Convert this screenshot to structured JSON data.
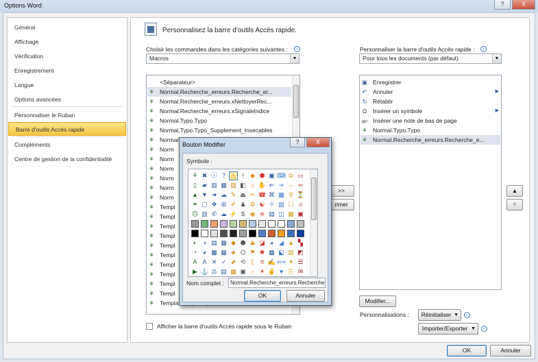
{
  "window": {
    "title": "Options Word",
    "help_label": "?",
    "close_label": "X"
  },
  "nav": {
    "items": [
      {
        "label": "Général"
      },
      {
        "label": "Affichage"
      },
      {
        "label": "Vérification"
      },
      {
        "label": "Enregistrement"
      },
      {
        "label": "Langue"
      },
      {
        "label": "Options avancées"
      },
      {
        "label": "Personnaliser le Ruban"
      },
      {
        "label": "Barre d'outils Accès rapide"
      },
      {
        "label": "Compléments"
      },
      {
        "label": "Centre de gestion de la confidentialité"
      }
    ],
    "selected": "Barre d'outils Accès rapide"
  },
  "main": {
    "header": "Personnalisez la barre d'outils Accès rapide.",
    "left": {
      "choose_label": "Choisir les commandes dans les catégories suivantes :",
      "category_value": "Macros",
      "commands": [
        {
          "label": "<Séparateur>",
          "icon": "none"
        },
        {
          "label": "Normal.Recherche_erreurs.Recherche_er...",
          "icon": "macro-icon",
          "selected": true
        },
        {
          "label": "Normal.Recherche_erreurs.xNettoyerRec...",
          "icon": "macro-icon"
        },
        {
          "label": "Normal.Recherche_erreurs.xSignaleIndice",
          "icon": "macro-icon"
        },
        {
          "label": "Normal.Typo.Typo",
          "icon": "macro-icon"
        },
        {
          "label": "Normal.Typo.Typo_Supplement_Insecables",
          "icon": "macro-icon"
        },
        {
          "label": "Normal.TypoEspaceInsec.espaceInsec",
          "icon": "macro-icon"
        },
        {
          "label": "Norm",
          "icon": "macro-icon"
        },
        {
          "label": "Norm",
          "icon": "macro-icon"
        },
        {
          "label": "Norm",
          "icon": "macro-icon"
        },
        {
          "label": "Norm",
          "icon": "macro-icon"
        },
        {
          "label": "Norm",
          "icon": "macro-icon"
        },
        {
          "label": "Norm",
          "icon": "macro-icon"
        },
        {
          "label": "Templ",
          "icon": "macro-icon"
        },
        {
          "label": "Templ",
          "icon": "macro-icon"
        },
        {
          "label": "Templ",
          "icon": "macro-icon"
        },
        {
          "label": "Templ",
          "icon": "macro-icon"
        },
        {
          "label": "Templ",
          "icon": "macro-icon"
        },
        {
          "label": "Templ",
          "icon": "macro-icon"
        },
        {
          "label": "Templ",
          "icon": "macro-icon"
        },
        {
          "label": "Templ",
          "icon": "macro-icon"
        },
        {
          "label": "Templ",
          "icon": "macro-icon"
        },
        {
          "label": "Templ",
          "icon": "macro-icon"
        },
        {
          "label": "TemplateProject.Typo.xSuppEspacesCon...",
          "icon": "macro-icon"
        }
      ],
      "show_below_label": "Afficher la barre d'outils Accès rapide sous le Ruban"
    },
    "add_button": ">>",
    "remove_button": "rimer",
    "right": {
      "customize_label": "Personnaliser la barre d'outils Accès rapide :",
      "scope_value": "Pour tous les documents (par défaut)",
      "items": [
        {
          "label": "Enregistrer",
          "icon": "save-icon"
        },
        {
          "label": "Annuler",
          "icon": "undo-icon",
          "has_submenu": true
        },
        {
          "label": "Rétablir",
          "icon": "redo-icon"
        },
        {
          "label": "Insérer un symbole",
          "icon": "omega-icon",
          "has_submenu": true
        },
        {
          "label": "Insérer une note de bas de page",
          "icon": "footnote-icon"
        },
        {
          "label": "Normal.Typo.Typo",
          "icon": "macro-icon"
        },
        {
          "label": "Normal.Recherche_erreurs.Recherche_e...",
          "icon": "macro-icon",
          "selected": true
        }
      ],
      "modify_button": "Modifier...",
      "customizations_label": "Personnalisations :",
      "reset_button": "Réinitialiser",
      "import_export_button": "Importer/Exporter",
      "move_up": "▲",
      "move_down": "▼"
    }
  },
  "dialog": {
    "title": "Bouton Modifier",
    "help_label": "?",
    "close_label": "X",
    "symbol_label": "Symbole :",
    "full_name_label": "Nom complet :",
    "full_name_value": "Normal.Recherche_erreurs.Recherche",
    "ok": "OK",
    "cancel": "Annuler",
    "symbols": [
      "⚘",
      "✖",
      "ⓘ",
      "?",
      "⚠",
      "!",
      "◆",
      "⬢",
      "▣",
      "⌨",
      "⧉",
      "▭",
      "▯",
      "▰",
      "▤",
      "▦",
      "▨",
      "◧",
      "⌂",
      "✋",
      "⇐",
      "⇒",
      "⇔",
      "⇦",
      "▲",
      "▼",
      "➜",
      "☁",
      "✎",
      "⏏",
      "✂",
      "☎",
      "⌘",
      "▩",
      "⚲",
      "⏳",
      "⏷",
      "▢",
      "✥",
      "⊞",
      "✐",
      "♟",
      "⚙",
      "☯",
      "⌾",
      "▧",
      "☐",
      "☺",
      "☹",
      "▥",
      "✆",
      "☁",
      "⚡",
      "$",
      "◉",
      "≋",
      "▤",
      "◫",
      "▦",
      "▣",
      "",
      "",
      "",
      "",
      "",
      "",
      "",
      "",
      "",
      "",
      "",
      "",
      "",
      "",
      "",
      "",
      "",
      "",
      "",
      "",
      "",
      "",
      "",
      "",
      "◐",
      "◑",
      "▤",
      "▦",
      "◆",
      "⬢",
      "⛰",
      "◪",
      "◕",
      "◢",
      "▲",
      "▚",
      "◔",
      "◕",
      "▩",
      "▦",
      "◈",
      "⌬",
      "⚑",
      "✱",
      "▦",
      "⬕",
      "▤",
      "◩",
      "A",
      "A",
      "✕",
      "✓",
      "⬈",
      "⟲",
      "⟦",
      "π",
      "✍",
      "⟺",
      "✦",
      "☰",
      "▶",
      "⚓",
      "⚖",
      "▤",
      "▦",
      "▣",
      "☼",
      "☀",
      "✌",
      "♥",
      "⎘",
      "✉"
    ],
    "color_row_a": [
      "#9b9b9b",
      "#78b878",
      "#e8a070",
      "#c8b4e0",
      "#b8d4a0",
      "#d4b878",
      "#b4c8e4",
      "#e8e8e8",
      "#f4f4f4",
      "#ffffff",
      "#8ca8d0",
      "#c0c0c0"
    ],
    "color_row_b": [
      "#000000",
      "#ffffff",
      "#e0e0e0",
      "#505050",
      "#202020",
      "#a0a0a0",
      "#000000",
      "#5080d0",
      "#d06030",
      "#f0a020",
      "#4070c0",
      "#1040a0"
    ]
  }
}
